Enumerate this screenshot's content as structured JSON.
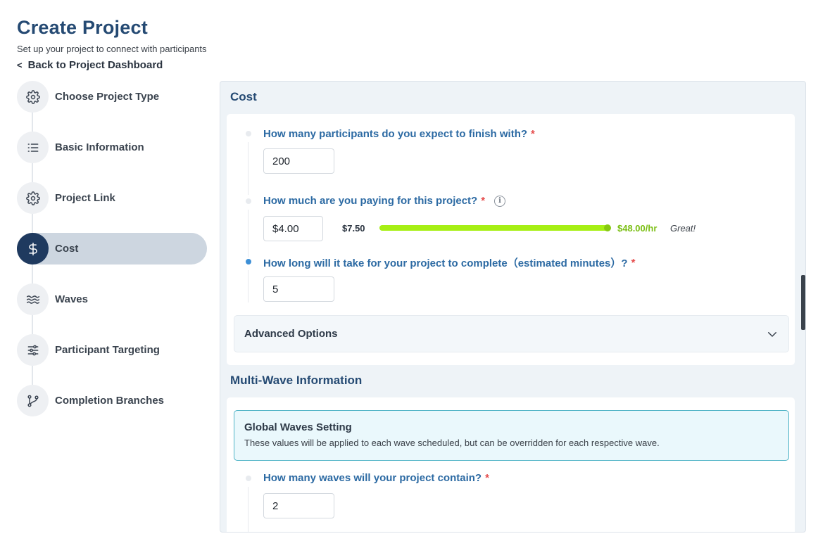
{
  "header": {
    "title": "Create Project",
    "subtitle": "Set up your project to connect with participants",
    "back_chevron": "<",
    "back_label": "Back to Project Dashboard"
  },
  "steps": [
    {
      "label": "Choose Project Type",
      "icon": "gear-icon"
    },
    {
      "label": "Basic Information",
      "icon": "list-icon"
    },
    {
      "label": "Project Link",
      "icon": "gear-icon"
    },
    {
      "label": "Cost",
      "icon": "dollar-icon",
      "active": true
    },
    {
      "label": "Waves",
      "icon": "waves-icon"
    },
    {
      "label": "Participant Targeting",
      "icon": "sliders-icon"
    },
    {
      "label": "Completion Branches",
      "icon": "branch-icon"
    }
  ],
  "cost": {
    "title": "Cost",
    "participants": {
      "label": "How many participants do you expect to finish with?",
      "required": "*",
      "value": "200"
    },
    "payment": {
      "label": "How much are you paying for this project?",
      "required": "*",
      "info": "i",
      "value": "$4.00"
    },
    "rate": {
      "min_label": "$7.50",
      "max_label": "$48.00/hr",
      "note": "Great!",
      "fill_fraction": 1.0
    },
    "duration": {
      "label": "How long will it take for your project to complete（estimated minutes）?",
      "required": "*",
      "value": "5"
    },
    "advanced_label": "Advanced Options"
  },
  "multi_wave": {
    "title": "Multi-Wave Information",
    "global_title": "Global Waves Setting",
    "global_desc": "These values will be applied to each wave scheduled, but can be overridden for each respective wave.",
    "waves": {
      "label": "How many waves will your project contain?",
      "required": "*",
      "value": "2"
    }
  },
  "colors": {
    "title": "#254a73",
    "question": "#2c6aa3",
    "active_step": "#1f3a5f",
    "slider": "#a6ef14",
    "required": "#e54b4b"
  }
}
